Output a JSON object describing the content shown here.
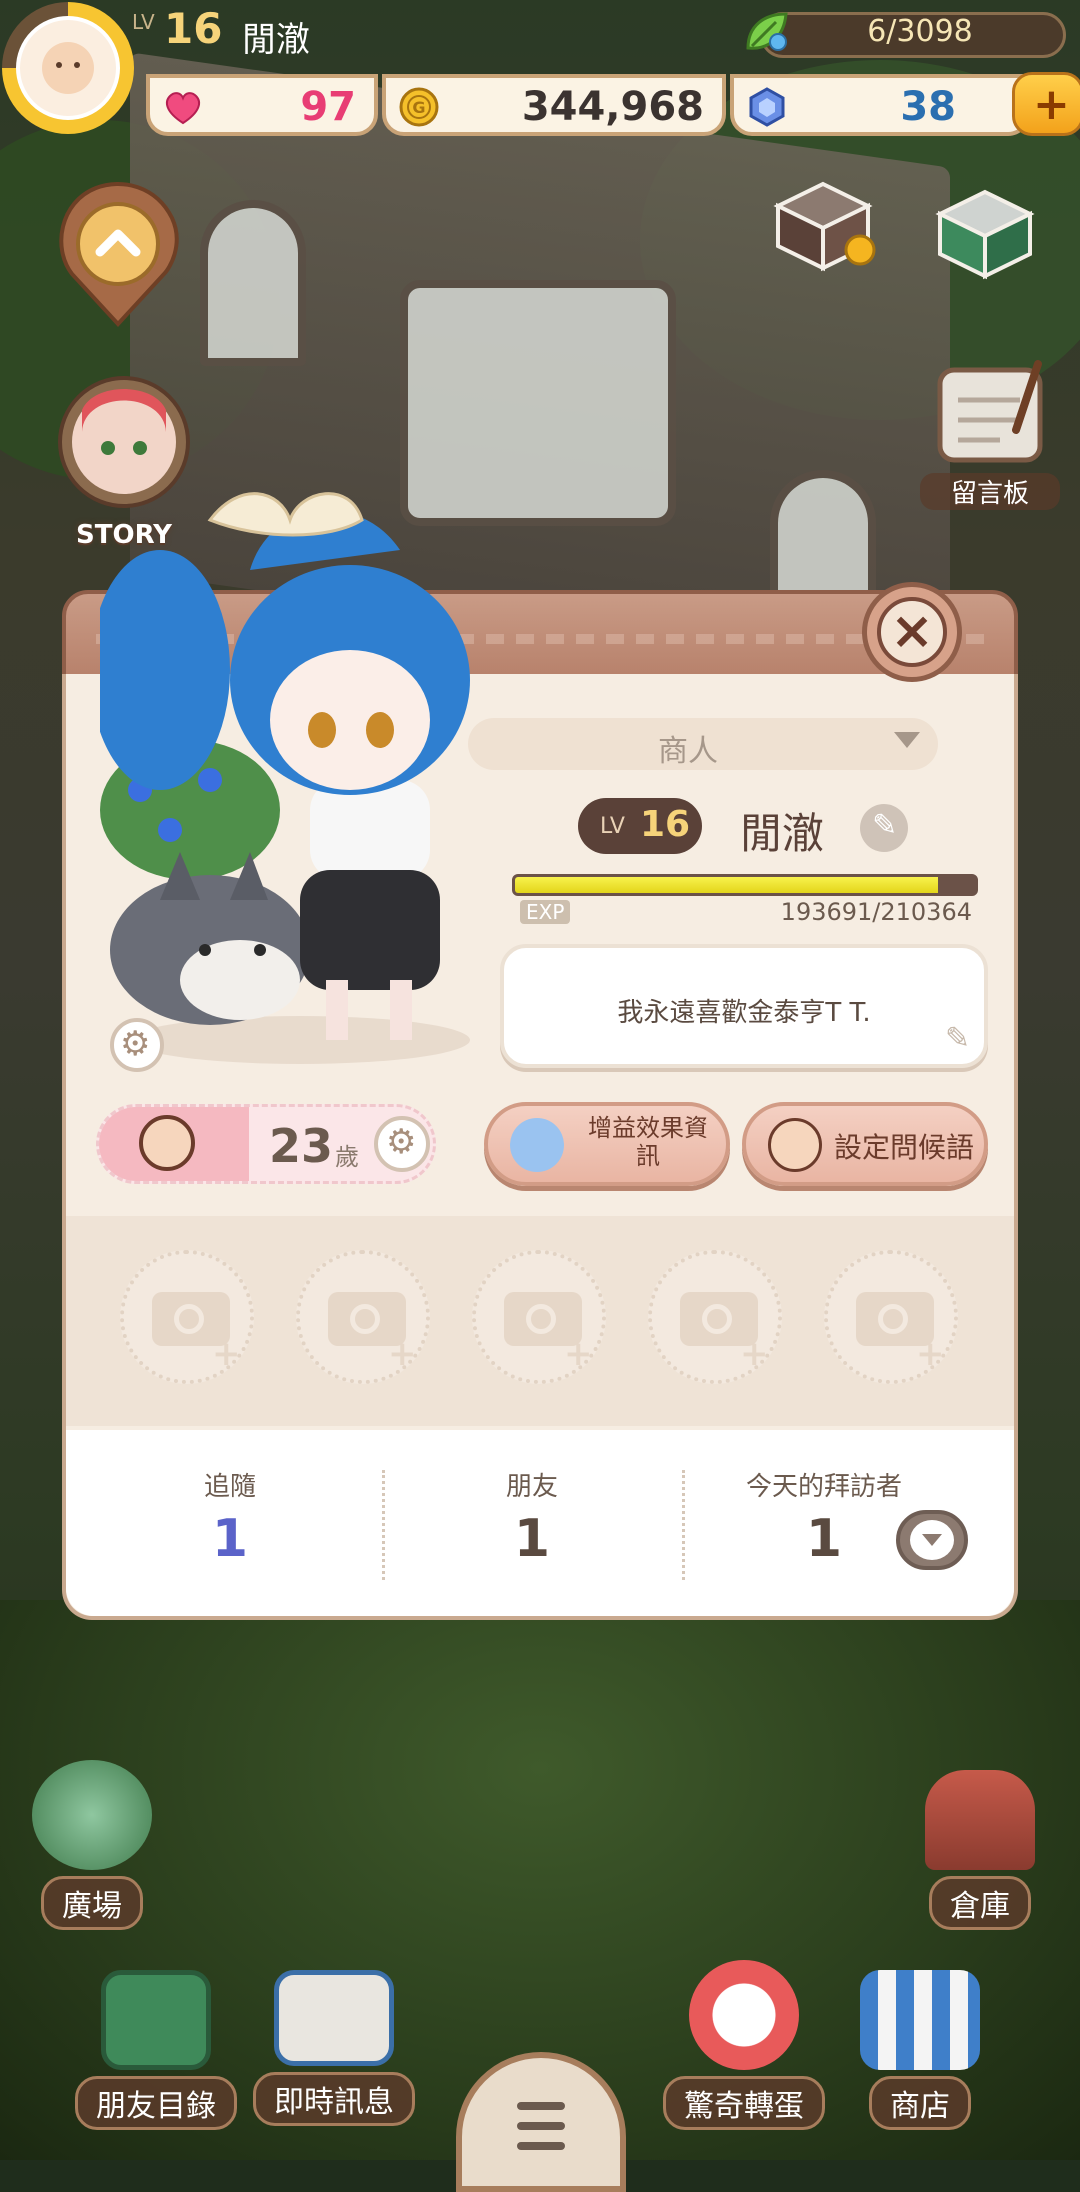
{
  "player": {
    "level_prefix": "LV",
    "level": "16",
    "name": "閒澈"
  },
  "resources": {
    "energy": "6/3098",
    "hearts": "97",
    "coins": "344,968",
    "gems": "38"
  },
  "side": {
    "story_label": "STORY",
    "board_label": "留言板"
  },
  "profile": {
    "job": "商人",
    "level_prefix": "LV",
    "level": "16",
    "name": "閒澈",
    "exp_label": "EXP",
    "exp_value": "193691/210364",
    "exp_fraction": 0.92,
    "greeting": "我永遠喜歡金泰亨T T.",
    "age": "23",
    "age_unit": "歲",
    "buff_button": "增益效果資\n訊",
    "greeting_button": "設定問候語",
    "stats": [
      {
        "label": "追隨",
        "value": "1"
      },
      {
        "label": "朋友",
        "value": "1"
      },
      {
        "label": "今天的拜訪者",
        "value": "1"
      }
    ]
  },
  "nav": {
    "plaza": "廣場",
    "warehouse": "倉庫",
    "friends": "朋友目錄",
    "messages": "即時訊息",
    "gacha": "驚奇轉蛋",
    "shop": "商店"
  },
  "colors": {
    "follow_num": "#5b63c9",
    "friend_num": "#5a4a40",
    "visitor_num": "#5a4a40",
    "heart": "#e83d74",
    "coin_text": "#3b3330",
    "gem_text": "#2b6fb0"
  }
}
